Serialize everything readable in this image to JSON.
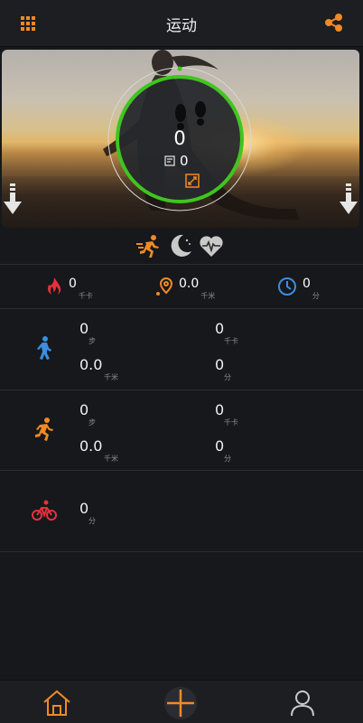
{
  "header": {
    "title": "运动",
    "menu_icon": "grid-icon",
    "share_icon": "share-icon"
  },
  "ring": {
    "steps": "0",
    "secondary_value": "0",
    "secondary_icon": "report-icon",
    "expand_icon": "expand-icon",
    "progress_color": "#3ec61e"
  },
  "modes": [
    {
      "name": "running-mode",
      "icon": "running-icon",
      "active": true
    },
    {
      "name": "sleep-mode",
      "icon": "moon-icon",
      "active": false
    },
    {
      "name": "heart-mode",
      "icon": "heart-rate-icon",
      "active": false
    }
  ],
  "summary": {
    "calories": {
      "value": "0",
      "unit": "千卡",
      "icon": "flame-icon",
      "color": "#e8303a"
    },
    "distance": {
      "value": "0.0",
      "unit": "千米",
      "icon": "location-pin-icon",
      "color": "#f08a24"
    },
    "duration": {
      "value": "0",
      "unit": "分",
      "icon": "clock-icon",
      "color": "#3a8fe0"
    }
  },
  "walking": {
    "icon_color": "#3a8fe0",
    "steps": {
      "value": "0",
      "unit": "步"
    },
    "calories": {
      "value": "0",
      "unit": "千卡"
    },
    "distance": {
      "value": "0.0",
      "unit": "千米"
    },
    "duration": {
      "value": "0",
      "unit": "分"
    }
  },
  "running": {
    "icon_color": "#f08a24",
    "steps": {
      "value": "0",
      "unit": "步"
    },
    "calories": {
      "value": "0",
      "unit": "千卡"
    },
    "distance": {
      "value": "0.0",
      "unit": "千米"
    },
    "duration": {
      "value": "0",
      "unit": "分"
    }
  },
  "cycling": {
    "icon_color": "#e8303a",
    "duration": {
      "value": "0",
      "unit": "分"
    }
  },
  "bottom_nav": [
    {
      "name": "home",
      "icon": "home-icon",
      "active": true
    },
    {
      "name": "add",
      "icon": "plus-icon",
      "active": false
    },
    {
      "name": "profile",
      "icon": "user-icon",
      "active": false
    }
  ],
  "colors": {
    "accent": "#f08a24",
    "background": "#16181c",
    "ring": "#3ec61e"
  }
}
